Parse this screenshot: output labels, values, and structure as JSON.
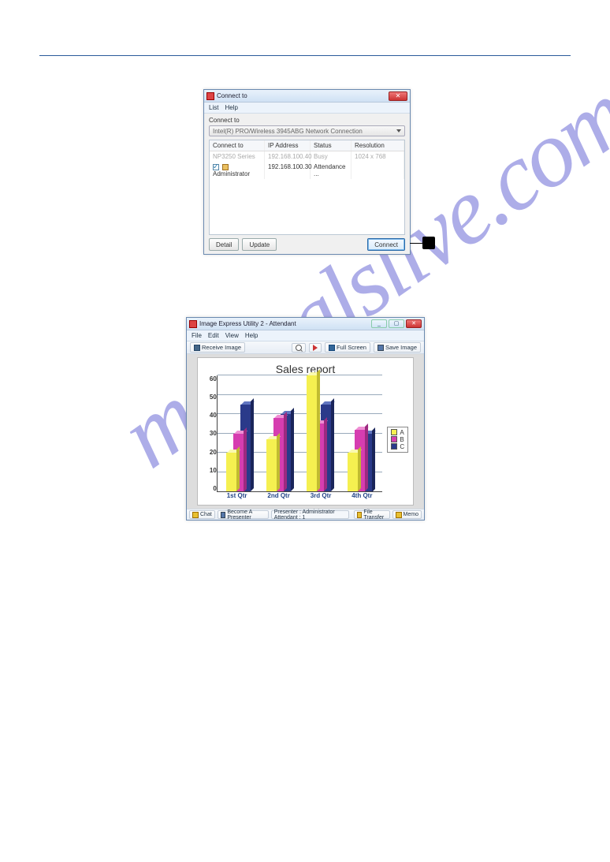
{
  "watermark_text": "manualslive.com",
  "dialog1": {
    "title": "Connect to",
    "menu": [
      "List",
      "Help"
    ],
    "section_label": "Connect to",
    "combo_text": "Intel(R) PRO/Wireless 3945ABG Network Connection",
    "columns": [
      "Connect to",
      "IP Address",
      "Status",
      "Resolution"
    ],
    "rows": [
      {
        "name": "NP3250 Series",
        "ip": "192.168.100.40",
        "status": "Busy",
        "res": "1024 x 768",
        "grey": true,
        "checked": false
      },
      {
        "name": "Administrator",
        "ip": "192.168.100.30",
        "status": "Attendance ...",
        "res": "",
        "grey": false,
        "checked": true
      }
    ],
    "buttons": {
      "detail": "Detail",
      "update": "Update",
      "connect": "Connect"
    }
  },
  "dialog2": {
    "title": "Image Express Utility 2 - Attendant",
    "menu": [
      "File",
      "Edit",
      "View",
      "Help"
    ],
    "toolbar": {
      "receive": "Receive Image",
      "fullscreen": "Full Screen",
      "saveimg": "Save Image"
    },
    "status": {
      "chat": "Chat",
      "become": "Become A Presenter",
      "presenter_attendant": "Presenter : Administrator   Attendant : 1",
      "filetransfer": "File Transfer",
      "memo": "Memo"
    }
  },
  "chart_data": {
    "type": "bar",
    "title": "Sales report",
    "categories": [
      "1st Qtr",
      "2nd Qtr",
      "3rd Qtr",
      "4th Qtr"
    ],
    "series": [
      {
        "name": "A",
        "values": [
          20,
          27,
          60,
          20
        ]
      },
      {
        "name": "B",
        "values": [
          30,
          38,
          35,
          32
        ]
      },
      {
        "name": "C",
        "values": [
          45,
          40,
          45,
          30
        ]
      }
    ],
    "ylabel": "",
    "xlabel": "",
    "ylim": [
      0,
      60
    ],
    "yticks": [
      0,
      10,
      20,
      30,
      40,
      50,
      60
    ]
  }
}
